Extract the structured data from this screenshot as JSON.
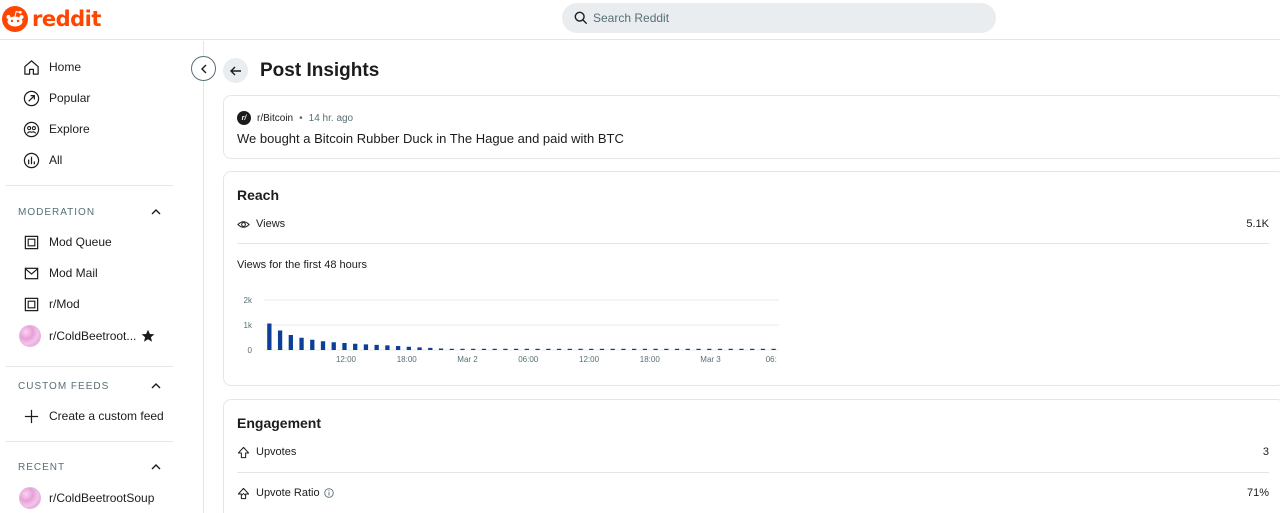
{
  "brand": {
    "name": "reddit",
    "accent": "#ff4500"
  },
  "search": {
    "placeholder": "Search Reddit",
    "icon": "search-icon"
  },
  "sidebar": {
    "nav": [
      {
        "label": "Home",
        "icon": "home-icon"
      },
      {
        "label": "Popular",
        "icon": "popular-icon"
      },
      {
        "label": "Explore",
        "icon": "explore-icon"
      },
      {
        "label": "All",
        "icon": "all-icon"
      }
    ],
    "moderation": {
      "heading": "MODERATION",
      "items": [
        {
          "label": "Mod Queue",
          "icon": "mod-queue-icon"
        },
        {
          "label": "Mod Mail",
          "icon": "mod-mail-icon"
        },
        {
          "label": "r/Mod",
          "icon": "mod-icon"
        },
        {
          "label": "r/ColdBeetroot...",
          "icon": "avatar"
        }
      ]
    },
    "custom_feeds": {
      "heading": "CUSTOM FEEDS",
      "create_label": "Create a custom feed"
    },
    "recent": {
      "heading": "RECENT",
      "items": [
        {
          "label": "r/ColdBeetrootSoup"
        }
      ]
    }
  },
  "page": {
    "title": "Post Insights"
  },
  "post": {
    "subreddit": "r/Bitcoin",
    "separator": "•",
    "age": "14 hr. ago",
    "title": "We bought a Bitcoin Rubber Duck in The Hague and paid with BTC"
  },
  "reach": {
    "heading": "Reach",
    "views_label": "Views",
    "views_value": "5.1K",
    "chart_caption": "Views for the first 48 hours"
  },
  "engagement": {
    "heading": "Engagement",
    "upvotes_label": "Upvotes",
    "upvotes_value": "3",
    "ratio_label": "Upvote Ratio",
    "ratio_value": "71%"
  },
  "chart_data": {
    "type": "bar",
    "title": "",
    "xlabel": "",
    "ylabel": "",
    "ylim": [
      0,
      2000
    ],
    "y_ticks": [
      "0",
      "1k",
      "2k"
    ],
    "y_tick_values": [
      0,
      1000,
      2000
    ],
    "x_ticks": [
      "12:00",
      "18:00",
      "Mar 2",
      "06:00",
      "12:00",
      "18:00",
      "Mar 3",
      "06:"
    ],
    "grid": true,
    "bar_color": "#0e3f96",
    "values": [
      1060,
      780,
      600,
      490,
      410,
      350,
      310,
      280,
      250,
      225,
      205,
      185,
      160,
      130,
      105,
      85,
      60,
      40,
      25,
      15,
      10,
      8,
      6,
      5,
      5,
      4,
      4,
      4,
      4,
      3,
      3,
      3,
      3,
      3,
      3,
      3,
      3,
      3,
      3,
      3,
      3,
      3,
      3,
      3,
      3,
      3,
      3,
      3
    ]
  }
}
